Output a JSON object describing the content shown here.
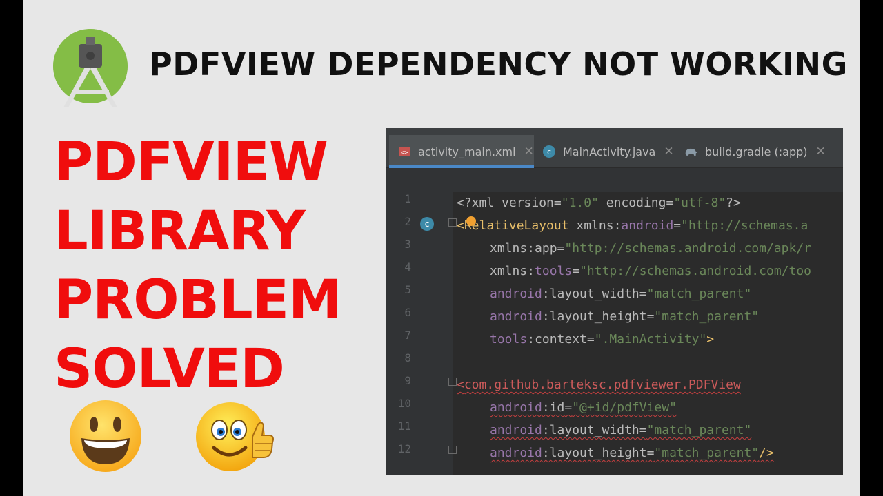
{
  "headline": "PDFVIEW DEPENDENCY NOT WORKING",
  "red_title": [
    "PDFVIEW",
    "LIBRARY",
    "PROBLEM",
    "SOLVED"
  ],
  "icons": {
    "logo": "android-studio-logo-icon",
    "emoji_1": "grinning-face-emoji-icon",
    "emoji_2": "thumbs-up-smiley-emoji-icon"
  },
  "ide": {
    "tabs": [
      {
        "label": "activity_main.xml",
        "icon": "xml-file-icon",
        "active": true
      },
      {
        "label": "MainActivity.java",
        "icon": "java-class-icon",
        "active": false
      },
      {
        "label": "build.gradle (:app)",
        "icon": "gradle-elephant-icon",
        "active": false
      }
    ],
    "line_numbers": [
      "1",
      "2",
      "3",
      "4",
      "5",
      "6",
      "7",
      "8",
      "9",
      "10",
      "11",
      "12"
    ],
    "lines": {
      "l1": {
        "a": "<?xml ",
        "b": "version",
        "c": "=",
        "d": "\"1.0\"",
        "e": " encoding",
        "f": "=",
        "g": "\"utf-8\"",
        "h": "?>"
      },
      "l2": {
        "a": "<",
        "b": "RelativeLayout",
        "c": " xmlns:",
        "d": "android",
        "e": "=",
        "f": "\"http://schemas.a"
      },
      "l3": {
        "a": "xmlns:app",
        "b": "=",
        "c": "\"http://schemas.android.com/apk/r"
      },
      "l4": {
        "a": "xmlns:",
        "b": "tools",
        "c": "=",
        "d": "\"http://schemas.android.com/too"
      },
      "l5": {
        "a": "android",
        "b": ":layout_width",
        "c": "=",
        "d": "\"match_parent\""
      },
      "l6": {
        "a": "android",
        "b": ":layout_height",
        "c": "=",
        "d": "\"match_parent\""
      },
      "l7": {
        "a": "tools",
        "b": ":context",
        "c": "=",
        "d": "\".MainActivity\"",
        "e": ">"
      },
      "l9": {
        "a": "<",
        "b": "com.github.barteksc.pdfviewer.PDFView"
      },
      "l10": {
        "a": "android",
        "b": ":id",
        "c": "=",
        "d": "\"@+id/pdfView\""
      },
      "l11": {
        "a": "android",
        "b": ":layout_width",
        "c": "=",
        "d": "\"match_parent\""
      },
      "l12": {
        "a": "android",
        "b": ":layout_height",
        "c": "=",
        "d": "\"match_parent\"",
        "e": "/>"
      }
    }
  },
  "colors": {
    "title_red": "#f00d0d",
    "ide_background": "#2b2b2b",
    "xml_tag": "#e8bf6a",
    "xml_namespace": "#9876aa",
    "xml_value": "#6a8759"
  }
}
